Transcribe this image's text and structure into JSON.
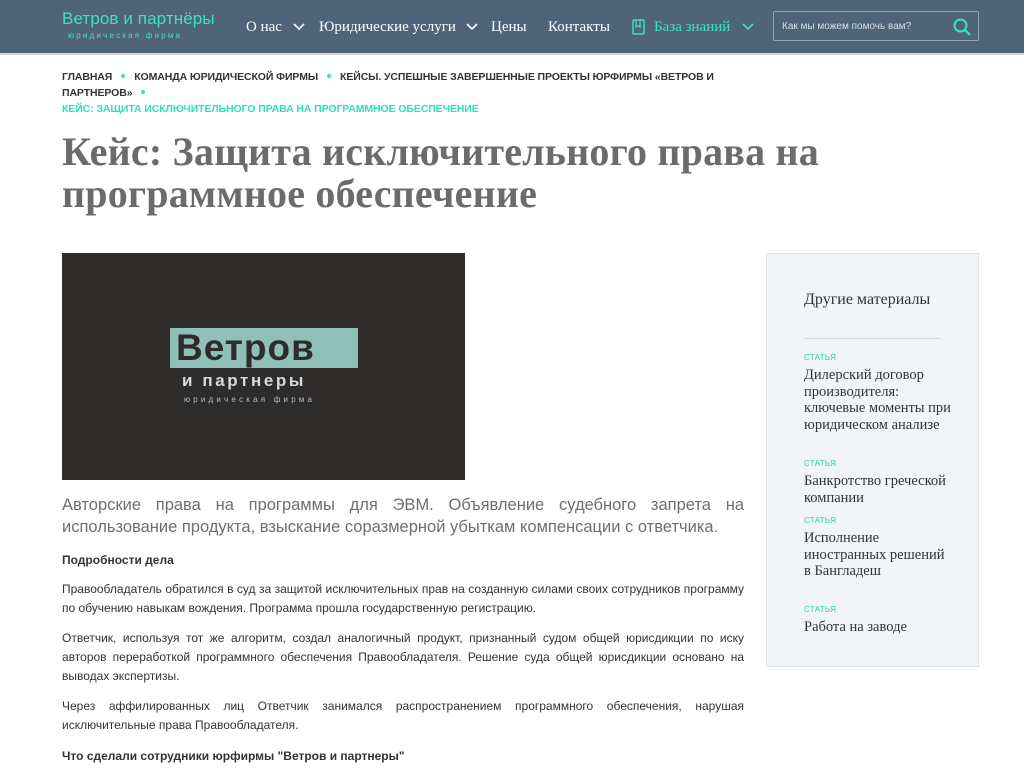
{
  "header": {
    "logo_name": "Ветров и партнёры",
    "logo_sub": "юридическая фирма",
    "nav": {
      "about": "О нас",
      "services": "Юридические услуги",
      "prices": "Цены",
      "contacts": "Контакты",
      "knowledge": "База знаний"
    },
    "search_placeholder": "Как мы можем помочь вам?",
    "icons": [
      "chevron-down-icon",
      "book-icon",
      "search-icon"
    ],
    "colors": {
      "bar": "#4f6478",
      "accent": "#3fe0c0"
    }
  },
  "breadcrumb": {
    "items": [
      "Главная",
      "Команда юридической фирмы",
      "Кейсы. Успешные завершенные проекты юрфирмы «Ветров и партнеров»"
    ],
    "current": "Кейс: Защита исключительного права на программное обеспечение"
  },
  "page": {
    "title": "Кейс: Защита исключительного права на программное обеспечение",
    "hero": {
      "word": "Ветров",
      "sub1": "и партнеры",
      "sub2": "юридическая фирма"
    },
    "lead": "Авторские права на программы для ЭВМ. Объявление судебного запрета на использование продукта, взыскание соразмерной убыткам компенсации с ответчика.",
    "section1": "Подробности дела",
    "para1": "Правообладатель обратился в суд за защитой исключительных прав на созданную силами своих сотрудников программу по обучению навыкам вождения. Программа прошла государственную регистрацию.",
    "para2": "Ответчик, используя тот же алгоритм, создал аналогичный продукт, признанный судом общей юрисдикции по иску авторов переработкой программного обеспечения Правообладателя. Решение суда общей юрисдикции основано на выводах экспертизы.",
    "para3": "Через аффилированных лиц Ответчик занимался распространением программного обеспечения, нарушая исключительные права Правообладателя.",
    "section2": "Что сделали сотрудники юрфирмы \"Ветров и партнеры\""
  },
  "sidebar": {
    "title": "Другие материалы",
    "items": [
      {
        "tag": "Статья",
        "label": "Дилерский договор производителя: ключевые моменты при юридическом анализе"
      },
      {
        "tag": "Статья",
        "label": "Банкротство греческой компании"
      },
      {
        "tag": "Статья",
        "label": "Исполнение иностранных решений в Бангладеш"
      },
      {
        "tag": "Статья",
        "label": "Работа на заводе"
      }
    ]
  }
}
